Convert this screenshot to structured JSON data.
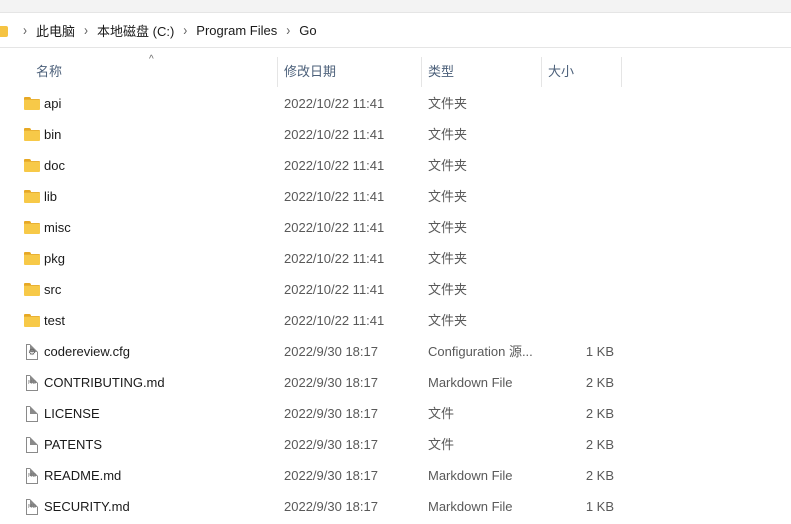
{
  "breadcrumb": {
    "items": [
      "此电脑",
      "本地磁盘 (C:)",
      "Program Files",
      "Go"
    ],
    "separator": "›"
  },
  "columns": {
    "name": "名称",
    "date": "修改日期",
    "type": "类型",
    "size": "大小",
    "sort_indicator": "^"
  },
  "files": [
    {
      "name": "api",
      "date": "2022/10/22 11:41",
      "type": "文件夹",
      "size": "",
      "icon": "folder-icon"
    },
    {
      "name": "bin",
      "date": "2022/10/22 11:41",
      "type": "文件夹",
      "size": "",
      "icon": "folder-icon"
    },
    {
      "name": "doc",
      "date": "2022/10/22 11:41",
      "type": "文件夹",
      "size": "",
      "icon": "folder-icon"
    },
    {
      "name": "lib",
      "date": "2022/10/22 11:41",
      "type": "文件夹",
      "size": "",
      "icon": "folder-icon"
    },
    {
      "name": "misc",
      "date": "2022/10/22 11:41",
      "type": "文件夹",
      "size": "",
      "icon": "folder-icon"
    },
    {
      "name": "pkg",
      "date": "2022/10/22 11:41",
      "type": "文件夹",
      "size": "",
      "icon": "folder-icon"
    },
    {
      "name": "src",
      "date": "2022/10/22 11:41",
      "type": "文件夹",
      "size": "",
      "icon": "folder-icon"
    },
    {
      "name": "test",
      "date": "2022/10/22 11:41",
      "type": "文件夹",
      "size": "",
      "icon": "folder-icon"
    },
    {
      "name": "codereview.cfg",
      "date": "2022/9/30 18:17",
      "type": "Configuration 源...",
      "size": "1 KB",
      "icon": "config-file-icon"
    },
    {
      "name": "CONTRIBUTING.md",
      "date": "2022/9/30 18:17",
      "type": "Markdown File",
      "size": "2 KB",
      "icon": "md-file-icon"
    },
    {
      "name": "LICENSE",
      "date": "2022/9/30 18:17",
      "type": "文件",
      "size": "2 KB",
      "icon": "file-icon"
    },
    {
      "name": "PATENTS",
      "date": "2022/9/30 18:17",
      "type": "文件",
      "size": "2 KB",
      "icon": "file-icon"
    },
    {
      "name": "README.md",
      "date": "2022/9/30 18:17",
      "type": "Markdown File",
      "size": "2 KB",
      "icon": "md-file-icon"
    },
    {
      "name": "SECURITY.md",
      "date": "2022/9/30 18:17",
      "type": "Markdown File",
      "size": "1 KB",
      "icon": "md-file-icon"
    }
  ]
}
